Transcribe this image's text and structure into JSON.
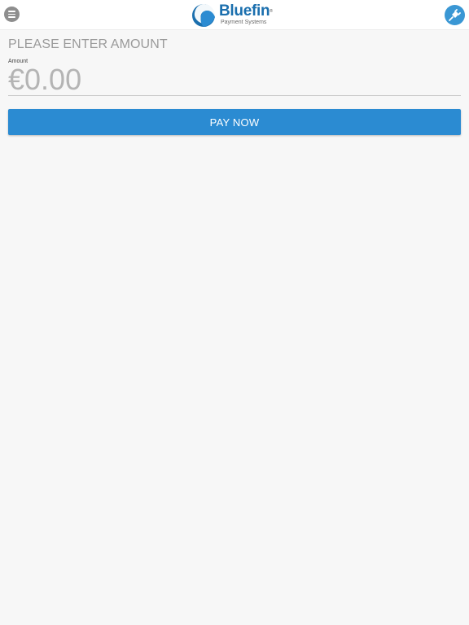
{
  "header": {
    "brand_name": "Bluefin",
    "brand_trademark": "®",
    "brand_tagline": "Payment Systems",
    "menu_icon": "hamburger-menu-icon",
    "connect_icon": "plug-connection-icon",
    "accent_color": "#2b8bd2"
  },
  "payment": {
    "heading": "PLEASE ENTER AMOUNT",
    "amount_label": "Amount",
    "amount_placeholder": "€0.00",
    "pay_button_label": "PAY NOW"
  }
}
